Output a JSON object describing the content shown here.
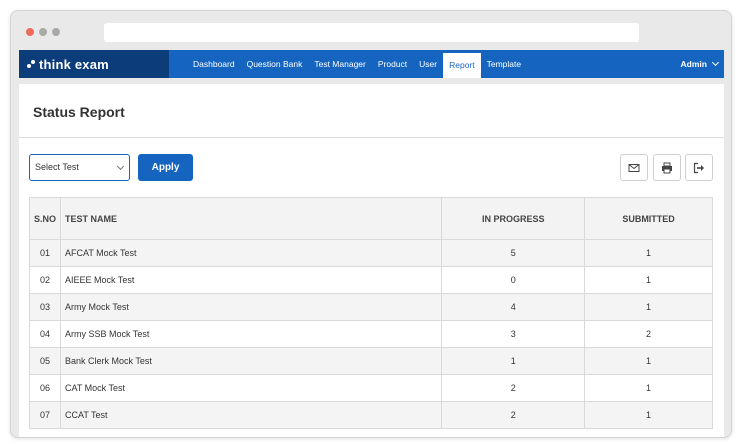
{
  "brand": {
    "name": "think exam"
  },
  "nav": {
    "items": [
      {
        "label": "Dashboard"
      },
      {
        "label": "Question Bank"
      },
      {
        "label": "Test Manager"
      },
      {
        "label": "Product"
      },
      {
        "label": "User"
      },
      {
        "label": "Report",
        "active": true
      },
      {
        "label": "Template"
      }
    ],
    "user_label": "Admin"
  },
  "page": {
    "title": "Status Report"
  },
  "filters": {
    "select_value": "Select Test",
    "apply_label": "Apply"
  },
  "toolbar": {
    "icons": [
      "mail-icon",
      "print-icon",
      "export-icon"
    ]
  },
  "table": {
    "headers": {
      "sno": "S.NO",
      "name": "TEST NAME",
      "in_progress": "IN PROGRESS",
      "submitted": "SUBMITTED"
    },
    "rows": [
      {
        "sno": "01",
        "name": "AFCAT Mock Test",
        "in_progress": "5",
        "submitted": "1"
      },
      {
        "sno": "02",
        "name": "AIEEE Mock Test",
        "in_progress": "0",
        "submitted": "1"
      },
      {
        "sno": "03",
        "name": "Army Mock Test",
        "in_progress": "4",
        "submitted": "1"
      },
      {
        "sno": "04",
        "name": "Army SSB Mock Test",
        "in_progress": "3",
        "submitted": "2"
      },
      {
        "sno": "05",
        "name": "Bank Clerk Mock Test",
        "in_progress": "1",
        "submitted": "1"
      },
      {
        "sno": "06",
        "name": "CAT Mock Test",
        "in_progress": "2",
        "submitted": "1"
      },
      {
        "sno": "07",
        "name": "CCAT Test",
        "in_progress": "2",
        "submitted": "1"
      }
    ]
  },
  "colors": {
    "primary": "#1565c0",
    "logo_bg": "#0d3c7a",
    "close_dot": "#ee6a5f"
  }
}
